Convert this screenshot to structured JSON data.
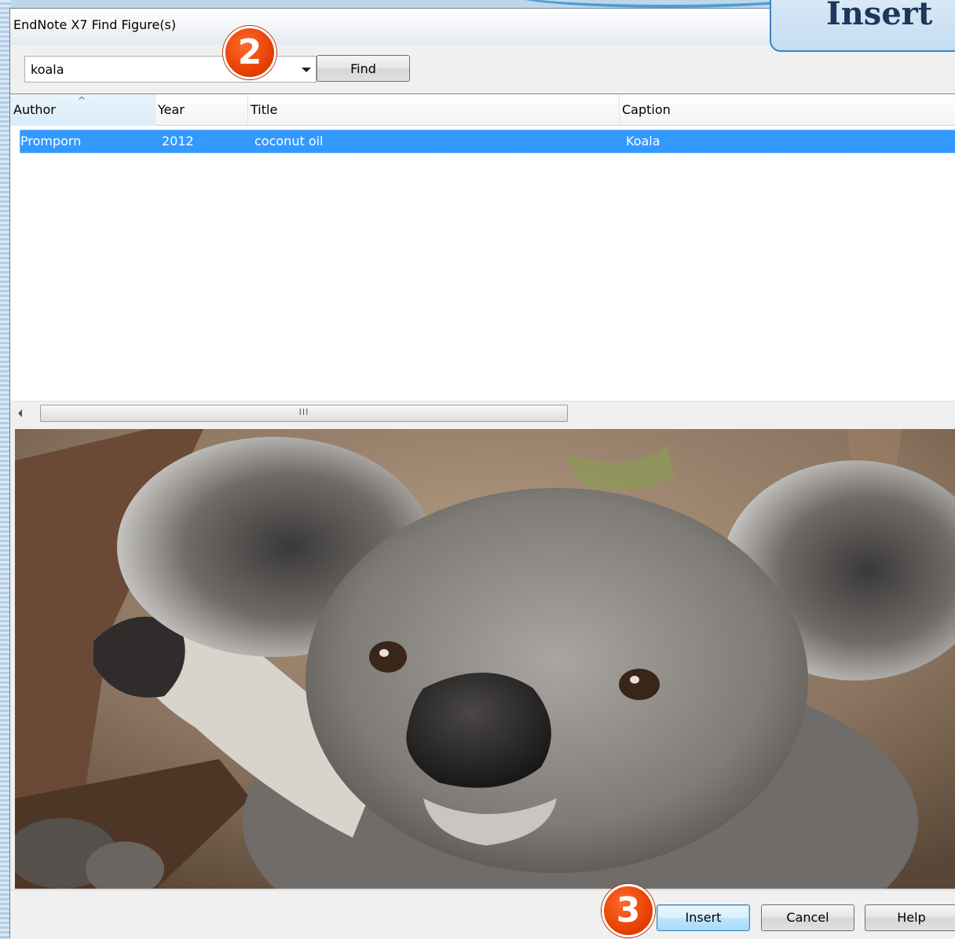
{
  "window": {
    "title": "EndNote X7 Find Figure(s)"
  },
  "overlay": {
    "heading": "Insert",
    "step_2": "2",
    "step_3": "3"
  },
  "search": {
    "value": "koala",
    "find_label": "Find"
  },
  "table": {
    "columns": [
      "Author",
      "Year",
      "Title",
      "Caption"
    ],
    "rows": [
      {
        "author": "Promporn",
        "year": "2012",
        "title": "coconut oil",
        "caption": "Koala",
        "selected": true
      }
    ]
  },
  "scrollbar": {
    "thumb_grip": "III"
  },
  "preview": {
    "subject": "koala photograph"
  },
  "footer": {
    "insert_label": "Insert",
    "cancel_label": "Cancel",
    "help_label": "Help"
  },
  "colors": {
    "selection": "#3399ff",
    "callout": "#e84a0c",
    "tab_border": "#3a82c4"
  },
  "icons": [
    "sort-ascending-icon",
    "dropdown-arrow-icon",
    "scroll-left-arrow-icon"
  ]
}
